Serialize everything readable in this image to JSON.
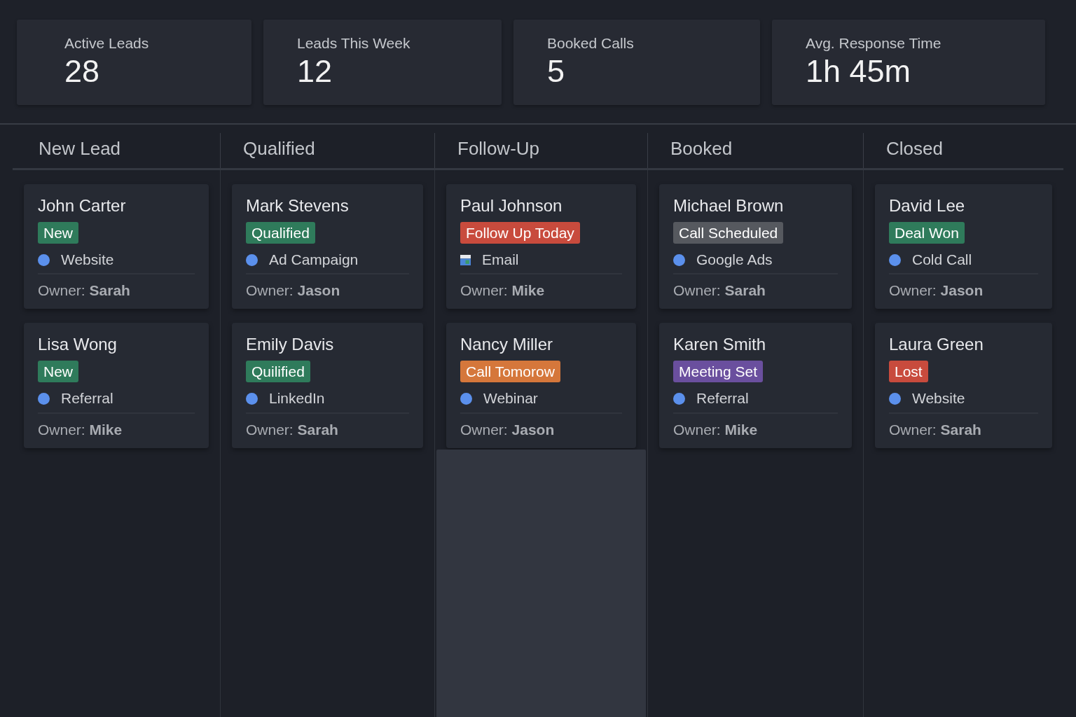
{
  "metrics": [
    {
      "label": "Active Leads",
      "value": "28"
    },
    {
      "label": "Leads This Week",
      "value": "12"
    },
    {
      "label": "Booked Calls",
      "value": "5"
    },
    {
      "label": "Avg. Response Time",
      "value": "1h 45m"
    }
  ],
  "columns": [
    {
      "title": "New Lead",
      "drop_target": false,
      "cards": [
        {
          "name": "John Carter",
          "tag": {
            "text": "New",
            "color": "#2f7b5b"
          },
          "source": {
            "kind": "dot",
            "text": "Website"
          },
          "owner": "Owner: **Sarah**"
        },
        {
          "name": "Lisa Wong",
          "tag": {
            "text": "New",
            "color": "#2f7b5b"
          },
          "source": {
            "kind": "dot",
            "text": "Referral"
          },
          "owner": "Owner: **Mike**"
        }
      ]
    },
    {
      "title": "Qualified",
      "drop_target": false,
      "cards": [
        {
          "name": "Mark Stevens",
          "tag": {
            "text": "Qualified",
            "color": "#2f7b5b"
          },
          "source": {
            "kind": "dot",
            "text": "Ad Campaign"
          },
          "owner": "Owner: **Jason**"
        },
        {
          "name": "Emily Davis",
          "tag": {
            "text": "Quilified",
            "color": "#2f7b5b"
          },
          "source": {
            "kind": "dot",
            "text": "LinkedIn"
          },
          "owner": "Owner: **Sarah**"
        }
      ]
    },
    {
      "title": "Follow-Up",
      "drop_target": true,
      "cards": [
        {
          "name": "Paul Johnson",
          "tag": {
            "text": "Follow Up Today",
            "color": "#c84b3d"
          },
          "source": {
            "kind": "mail",
            "text": "Email"
          },
          "owner": "Owner: **Mike**"
        },
        {
          "name": "Nancy Miller",
          "tag": {
            "text": "Call Tomorow",
            "color": "#d5773b"
          },
          "source": {
            "kind": "dot",
            "text": "Webinar"
          },
          "owner": "Owner: **Jason**"
        }
      ]
    },
    {
      "title": "Booked",
      "drop_target": false,
      "cards": [
        {
          "name": "Michael Brown",
          "tag": {
            "text": "Call Scheduled",
            "color": "#56595f"
          },
          "source": {
            "kind": "dot",
            "text": "Google Ads"
          },
          "owner": "Owner: **Sarah**"
        },
        {
          "name": "Karen Smith",
          "tag": {
            "text": "Meeting Set",
            "color": "#6a4f9e"
          },
          "source": {
            "kind": "dot",
            "text": "Referral"
          },
          "owner": "Owner: **Mike**"
        }
      ]
    },
    {
      "title": "Closed",
      "drop_target": false,
      "cards": [
        {
          "name": "David Lee",
          "tag": {
            "text": "Deal Won",
            "color": "#2f7b5b"
          },
          "source": {
            "kind": "dot",
            "text": "Cold Call"
          },
          "owner": "Owner: **Jason**"
        },
        {
          "name": "Laura Green",
          "tag": {
            "text": "Lost",
            "color": "#c84b3d"
          },
          "source": {
            "kind": "dot",
            "text": "Website"
          },
          "owner": "Owner: **Sarah**"
        }
      ]
    }
  ]
}
